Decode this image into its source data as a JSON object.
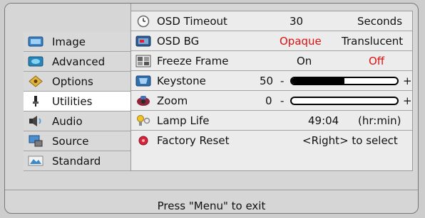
{
  "menu": {
    "items": [
      {
        "label": "Image",
        "icon": "image-icon"
      },
      {
        "label": "Advanced",
        "icon": "advanced-icon"
      },
      {
        "label": "Options",
        "icon": "options-icon"
      },
      {
        "label": "Utilities",
        "icon": "utilities-icon",
        "active": true
      },
      {
        "label": "Audio",
        "icon": "audio-icon"
      },
      {
        "label": "Source",
        "icon": "source-icon"
      },
      {
        "label": "Standard",
        "icon": "standard-icon"
      }
    ]
  },
  "settings": {
    "osd_timeout": {
      "label": "OSD Timeout",
      "value": "30",
      "unit": "Seconds"
    },
    "osd_bg": {
      "label": "OSD BG",
      "option_a": "Opaque",
      "option_b": "Translucent",
      "selected": "Opaque"
    },
    "freeze_frame": {
      "label": "Freeze Frame",
      "option_a": "On",
      "option_b": "Off",
      "selected": "Off"
    },
    "keystone": {
      "label": "Keystone",
      "value": "50",
      "minus": "-",
      "plus": "+",
      "level": 0.5
    },
    "zoom": {
      "label": "Zoom",
      "value": "0",
      "minus": "-",
      "plus": "+",
      "level": 0.0
    },
    "lamp_life": {
      "label": "Lamp Life",
      "value": "49:04",
      "unit": "(hr:min)"
    },
    "factory_reset": {
      "label": "Factory Reset",
      "action": "<Right> to select"
    }
  },
  "footer": {
    "hint": "Press \"Menu\" to exit"
  },
  "colors": {
    "highlight_red": "#d11111",
    "panel_bg": "#ececec",
    "frame_bg": "#d6d6d6"
  }
}
